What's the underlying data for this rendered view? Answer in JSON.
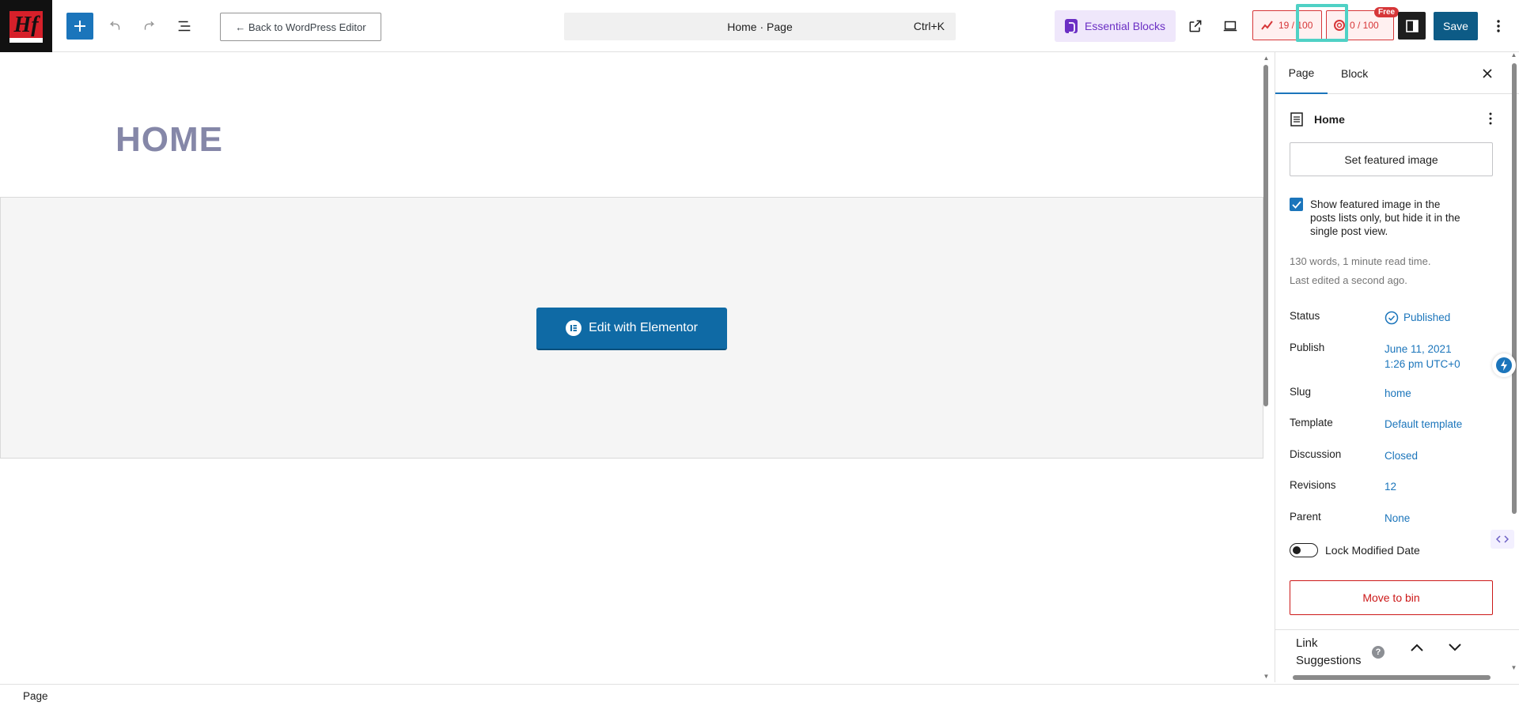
{
  "logo": {
    "text": "Hf",
    "subtext": "CARDS FOR"
  },
  "toolbar": {
    "back_label": "← Back to WordPress Editor",
    "command_title": "Home · Page",
    "command_shortcut": "Ctrl+K",
    "essential_blocks_label": "Essential Blocks",
    "score1": "19 / 100",
    "score2": "0 / 100",
    "free_badge": "Free",
    "save_label": "Save"
  },
  "canvas": {
    "heading": "HOME",
    "elementor_button_label": "Edit with Elementor"
  },
  "sidebar": {
    "tabs": [
      "Page",
      "Block"
    ],
    "doc_title": "Home",
    "featured_image_label": "Set featured image",
    "checkbox_label": "Show featured image in the posts lists only, but hide it in the single post view.",
    "checkbox_checked": true,
    "words_meta": "130 words, 1 minute read time.",
    "edited_meta": "Last edited a second ago.",
    "fields": {
      "status": {
        "label": "Status",
        "value": "Published"
      },
      "publish": {
        "label": "Publish",
        "value_line1": "June 11, 2021",
        "value_line2": "1:26 pm UTC+0"
      },
      "slug": {
        "label": "Slug",
        "value": "home"
      },
      "template": {
        "label": "Template",
        "value": "Default template"
      },
      "discussion": {
        "label": "Discussion",
        "value": "Closed"
      },
      "revisions": {
        "label": "Revisions",
        "value": "12"
      },
      "parent": {
        "label": "Parent",
        "value": "None"
      }
    },
    "lock_modified_label": "Lock Modified Date",
    "lock_modified_on": false,
    "move_to_bin_label": "Move to bin",
    "link_suggestions_label": "Link Suggestions"
  },
  "footer": {
    "breadcrumb": "Page"
  },
  "colors": {
    "accent": "#1b75bb",
    "save": "#0d5b86",
    "danger": "#cc1818",
    "essential_bg": "#efe7fb",
    "essential_text": "#6b2fc4",
    "heading": "#8587a8",
    "highlight": "#4fd1c5"
  }
}
